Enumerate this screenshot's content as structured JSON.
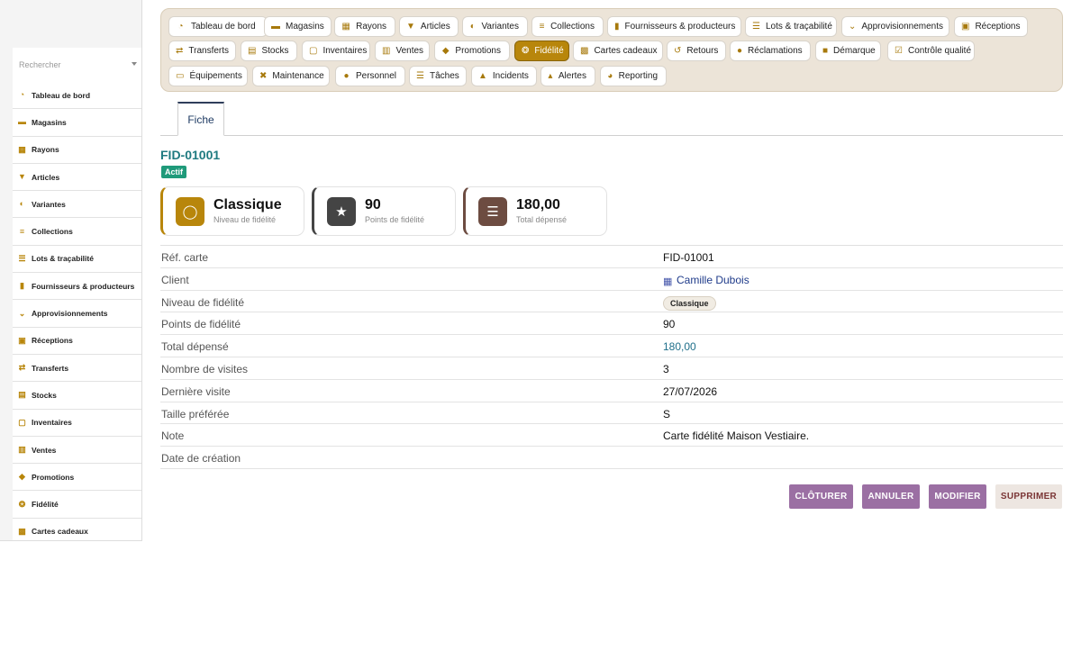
{
  "sidebar": {
    "search_placeholder": "Rechercher",
    "items": [
      {
        "label": "Tableau de bord",
        "icon": "dashboard-icon"
      },
      {
        "label": "Magasins",
        "icon": "store-icon"
      },
      {
        "label": "Rayons",
        "icon": "grid-icon"
      },
      {
        "label": "Articles",
        "icon": "shirt-icon"
      },
      {
        "label": "Variantes",
        "icon": "palette-icon"
      },
      {
        "label": "Collections",
        "icon": "layers-icon"
      },
      {
        "label": "Lots & traçabilité",
        "icon": "list-icon"
      },
      {
        "label": "Fournisseurs & producteurs",
        "icon": "factory-icon"
      },
      {
        "label": "Approvisionnements",
        "icon": "cart-icon"
      },
      {
        "label": "Réceptions",
        "icon": "truck-icon"
      },
      {
        "label": "Transferts",
        "icon": "arrows-icon"
      },
      {
        "label": "Stocks",
        "icon": "boxes-icon"
      },
      {
        "label": "Inventaires",
        "icon": "clipboard-icon"
      },
      {
        "label": "Ventes",
        "icon": "cash-register-icon"
      },
      {
        "label": "Promotions",
        "icon": "tag-icon"
      },
      {
        "label": "Fidélité",
        "icon": "award-icon"
      },
      {
        "label": "Cartes cadeaux",
        "icon": "gift-icon"
      }
    ]
  },
  "topnav": {
    "items": [
      {
        "label": "Tableau de bord",
        "icon": "dashboard-icon",
        "active": false
      },
      {
        "label": "Magasins",
        "icon": "store-icon",
        "active": false
      },
      {
        "label": "Rayons",
        "icon": "grid-icon",
        "active": false
      },
      {
        "label": "Articles",
        "icon": "shirt-icon",
        "active": false
      },
      {
        "label": "Variantes",
        "icon": "palette-icon",
        "active": false
      },
      {
        "label": "Collections",
        "icon": "layers-icon",
        "active": false
      },
      {
        "label": "Fournisseurs & producteurs",
        "icon": "factory-icon",
        "active": false
      },
      {
        "label": "Lots & traçabilité",
        "icon": "list-icon",
        "active": false
      },
      {
        "label": "Approvisionnements",
        "icon": "cart-icon",
        "active": false
      },
      {
        "label": "Réceptions",
        "icon": "truck-icon",
        "active": false
      },
      {
        "label": "Transferts",
        "icon": "arrows-icon",
        "active": false
      },
      {
        "label": "Stocks",
        "icon": "boxes-icon",
        "active": false
      },
      {
        "label": "Inventaires",
        "icon": "clipboard-icon",
        "active": false
      },
      {
        "label": "Ventes",
        "icon": "cash-register-icon",
        "active": false
      },
      {
        "label": "Promotions",
        "icon": "tag-icon",
        "active": false
      },
      {
        "label": "Fidélité",
        "icon": "award-icon",
        "active": true
      },
      {
        "label": "Cartes cadeaux",
        "icon": "gift-icon",
        "active": false
      },
      {
        "label": "Retours",
        "icon": "undo-icon",
        "active": false
      },
      {
        "label": "Réclamations",
        "icon": "comment-icon",
        "active": false
      },
      {
        "label": "Démarque",
        "icon": "trash-icon",
        "active": false
      },
      {
        "label": "Contrôle qualité",
        "icon": "clipboard-check-icon",
        "active": false
      },
      {
        "label": "Équipements",
        "icon": "monitor-icon",
        "active": false
      },
      {
        "label": "Maintenance",
        "icon": "tools-icon",
        "active": false
      },
      {
        "label": "Personnel",
        "icon": "users-icon",
        "active": false
      },
      {
        "label": "Tâches",
        "icon": "tasks-icon",
        "active": false
      },
      {
        "label": "Incidents",
        "icon": "warning-icon",
        "active": false
      },
      {
        "label": "Alertes",
        "icon": "bell-icon",
        "active": false
      },
      {
        "label": "Reporting",
        "icon": "pie-chart-icon",
        "active": false
      }
    ]
  },
  "tabs": {
    "fiche": "Fiche"
  },
  "record": {
    "id": "FID-01001",
    "status": "Actif",
    "status_color": "#1f9a7a"
  },
  "cards": [
    {
      "value": "Classique",
      "label": "Niveau de fidélité",
      "icon": "award-icon",
      "color": "#b8860b"
    },
    {
      "value": "90",
      "label": "Points de fidélité",
      "icon": "star-icon",
      "color": "#444444"
    },
    {
      "value": "180,00",
      "label": "Total dépensé",
      "icon": "coins-icon",
      "color": "#6d4c41"
    }
  ],
  "details": {
    "card_ref": {
      "label": "Réf. carte",
      "value": "FID-01001"
    },
    "client": {
      "label": "Client",
      "value": "Camille Dubois"
    },
    "tier": {
      "label": "Niveau de fidélité",
      "value": "Classique"
    },
    "points": {
      "label": "Points de fidélité",
      "value": "90"
    },
    "total_spent": {
      "label": "Total dépensé",
      "value": "180,00"
    },
    "visits": {
      "label": "Nombre de visites",
      "value": "3"
    },
    "last_visit": {
      "label": "Dernière visite",
      "value": "27/07/2026"
    },
    "size": {
      "label": "Taille préférée",
      "value": "S"
    },
    "note": {
      "label": "Note",
      "value": "Carte fidélité Maison Vestiaire."
    },
    "created": {
      "label": "Date de création",
      "value": ""
    }
  },
  "actions": {
    "close": "CLÔTURER",
    "cancel": "ANNULER",
    "edit": "MODIFIER",
    "delete": "SUPPRIMER"
  },
  "colors": {
    "accent": "#b8860b",
    "action": "#9b6fa3",
    "link": "#1f7a80"
  }
}
